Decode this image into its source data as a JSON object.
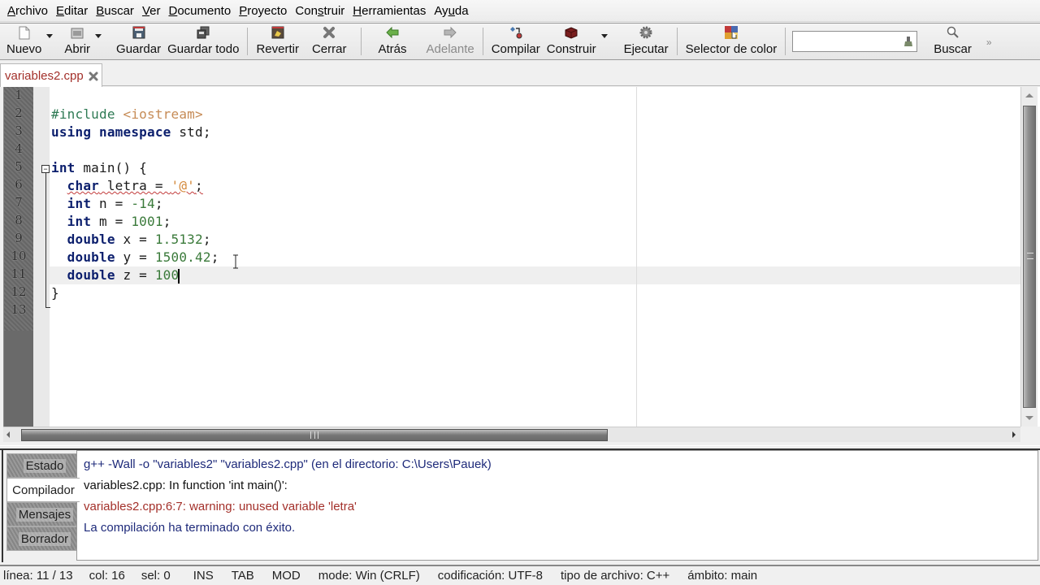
{
  "menu": [
    {
      "label_pre": "",
      "label_ul": "A",
      "label_post": "rchivo"
    },
    {
      "label_pre": "",
      "label_ul": "E",
      "label_post": "ditar"
    },
    {
      "label_pre": "",
      "label_ul": "B",
      "label_post": "uscar"
    },
    {
      "label_pre": "",
      "label_ul": "V",
      "label_post": "er"
    },
    {
      "label_pre": "",
      "label_ul": "D",
      "label_post": "ocumento"
    },
    {
      "label_pre": "",
      "label_ul": "P",
      "label_post": "royecto"
    },
    {
      "label_pre": "Con",
      "label_ul": "s",
      "label_post": "truir"
    },
    {
      "label_pre": "",
      "label_ul": "H",
      "label_post": "erramientas"
    },
    {
      "label_pre": "Ay",
      "label_ul": "u",
      "label_post": "da"
    }
  ],
  "toolbar": {
    "new": "Nuevo",
    "open": "Abrir",
    "save": "Guardar",
    "save_all": "Guardar todo",
    "revert": "Revertir",
    "close": "Cerrar",
    "back": "Atrás",
    "forward": "Adelante",
    "compile": "Compilar",
    "build": "Construir",
    "run": "Ejecutar",
    "color_picker": "Selector de color",
    "search_value": "",
    "search": "Buscar",
    "more": "»"
  },
  "tabs": [
    {
      "label": "variables2.cpp",
      "modified": true
    }
  ],
  "editor": {
    "line_numbers": [
      "1",
      "2",
      "3",
      "4",
      "5",
      "6",
      "7",
      "8",
      "9",
      "10",
      "11",
      "12",
      "13"
    ],
    "lines": [
      {
        "tokens": []
      },
      {
        "tokens": [
          {
            "t": "#include ",
            "c": "pp"
          },
          {
            "t": "<iostream>",
            "c": "inc"
          }
        ]
      },
      {
        "tokens": [
          {
            "t": "using",
            "c": "kw"
          },
          {
            "t": " ",
            "c": "plain"
          },
          {
            "t": "namespace",
            "c": "kw"
          },
          {
            "t": " std;",
            "c": "plain"
          }
        ]
      },
      {
        "tokens": []
      },
      {
        "tokens": [
          {
            "t": "int",
            "c": "kw"
          },
          {
            "t": " main() {",
            "c": "plain"
          }
        ]
      },
      {
        "tokens": [
          {
            "t": "  ",
            "c": "plain"
          },
          {
            "t": "char",
            "c": "kw sq"
          },
          {
            "t": " letra = ",
            "c": "plain sq"
          },
          {
            "t": "'@'",
            "c": "str sq"
          },
          {
            "t": ";",
            "c": "plain sq"
          }
        ]
      },
      {
        "tokens": [
          {
            "t": "  ",
            "c": "plain"
          },
          {
            "t": "int",
            "c": "kw"
          },
          {
            "t": " n = ",
            "c": "plain"
          },
          {
            "t": "-14",
            "c": "num"
          },
          {
            "t": ";",
            "c": "plain"
          }
        ]
      },
      {
        "tokens": [
          {
            "t": "  ",
            "c": "plain"
          },
          {
            "t": "int",
            "c": "kw"
          },
          {
            "t": " m = ",
            "c": "plain"
          },
          {
            "t": "1001",
            "c": "num"
          },
          {
            "t": ";",
            "c": "plain"
          }
        ]
      },
      {
        "tokens": [
          {
            "t": "  ",
            "c": "plain"
          },
          {
            "t": "double",
            "c": "kw"
          },
          {
            "t": " x = ",
            "c": "plain"
          },
          {
            "t": "1.5132",
            "c": "num"
          },
          {
            "t": ";",
            "c": "plain"
          }
        ]
      },
      {
        "tokens": [
          {
            "t": "  ",
            "c": "plain"
          },
          {
            "t": "double",
            "c": "kw"
          },
          {
            "t": " y = ",
            "c": "plain"
          },
          {
            "t": "1500.42",
            "c": "num"
          },
          {
            "t": ";",
            "c": "plain"
          }
        ]
      },
      {
        "tokens": [
          {
            "t": "  ",
            "c": "plain"
          },
          {
            "t": "double",
            "c": "kw"
          },
          {
            "t": " z = ",
            "c": "plain"
          },
          {
            "t": "100",
            "c": "num"
          }
        ],
        "caret": true
      },
      {
        "tokens": [
          {
            "t": "}",
            "c": "plain"
          }
        ]
      },
      {
        "tokens": []
      }
    ]
  },
  "messages": {
    "tabs": [
      "Estado",
      "Compilador",
      "Mensajes",
      "Borrador"
    ],
    "active_tab": "Compilador",
    "lines": [
      {
        "text": "g++ -Wall -o \"variables2\" \"variables2.cpp\" (en el directorio: C:\\Users\\Pauek)",
        "kind": "blue"
      },
      {
        "text": "variables2.cpp: In function 'int main()':",
        "kind": "black"
      },
      {
        "text": "variables2.cpp:6:7: warning: unused variable 'letra'",
        "kind": "red"
      },
      {
        "text": "La compilación ha terminado con éxito.",
        "kind": "blue"
      }
    ]
  },
  "status": {
    "line": "línea: 11 / 13",
    "col": "col: 16",
    "sel": "sel: 0",
    "ins": "INS",
    "tab": "TAB",
    "mod": "MOD",
    "mode": "mode: Win (CRLF)",
    "encoding": "codificación: UTF-8",
    "filetype": "tipo de archivo: C++",
    "scope": "ámbito: main"
  },
  "colors": {
    "keyword": "#0c1f6d",
    "number": "#3a7a3a",
    "char_literal": "#d4883a",
    "preprocessor": "#2e7a54",
    "include_path": "#c68b56",
    "tab_label": "#a3302a",
    "warning": "#a3302a",
    "info": "#1e2a7a"
  }
}
